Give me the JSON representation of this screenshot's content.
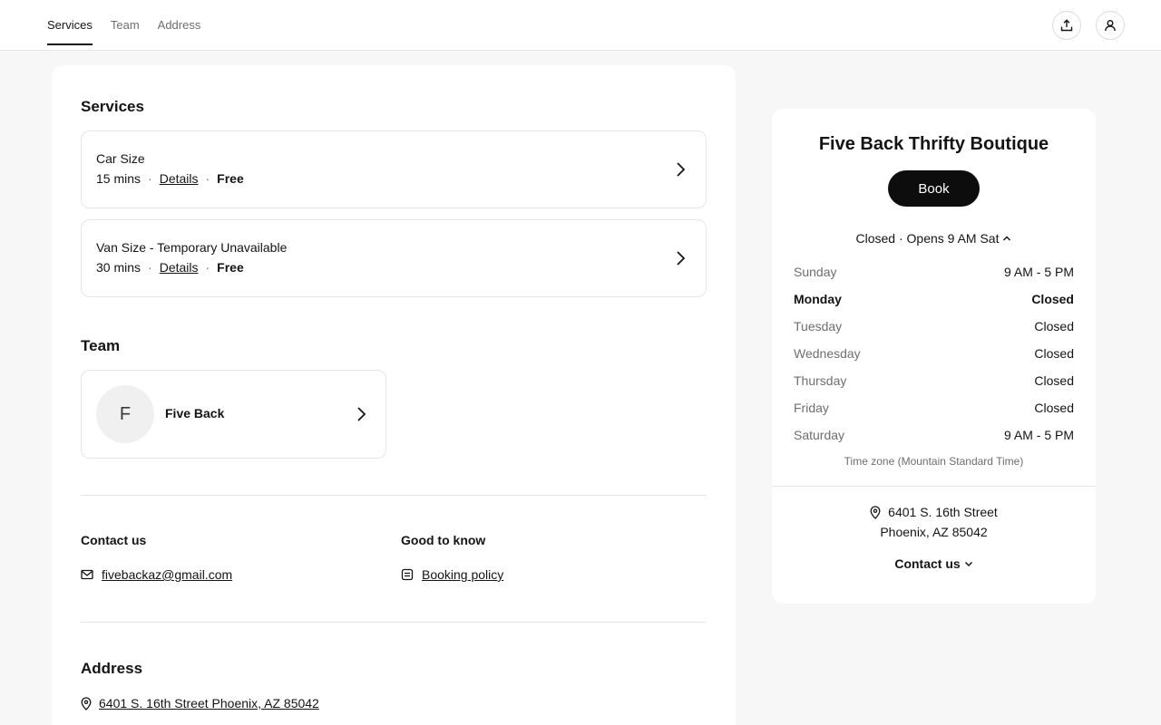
{
  "nav": {
    "tabs": [
      {
        "label": "Services"
      },
      {
        "label": "Team"
      },
      {
        "label": "Address"
      }
    ]
  },
  "services": {
    "title": "Services",
    "items": [
      {
        "name": "Car Size",
        "duration": "15 mins",
        "details": "Details",
        "price": "Free"
      },
      {
        "name": "Van Size - Temporary Unavailable",
        "duration": "30 mins",
        "details": "Details",
        "price": "Free"
      }
    ],
    "separator": "·"
  },
  "team": {
    "title": "Team",
    "members": [
      {
        "initial": "F",
        "name": "Five Back"
      }
    ]
  },
  "contact": {
    "title": "Contact us",
    "email": "fivebackaz@gmail.com"
  },
  "good_to_know": {
    "title": "Good to know",
    "policy": "Booking policy"
  },
  "address": {
    "title": "Address",
    "full": "6401 S. 16th Street Phoenix, AZ 85042"
  },
  "business": {
    "name": "Five Back Thrifty Boutique",
    "book_label": "Book",
    "status": "Closed · Opens 9 AM Sat",
    "hours": [
      {
        "day": "Sunday",
        "time": "9 AM - 5 PM"
      },
      {
        "day": "Monday",
        "time": "Closed"
      },
      {
        "day": "Tuesday",
        "time": "Closed"
      },
      {
        "day": "Wednesday",
        "time": "Closed"
      },
      {
        "day": "Thursday",
        "time": "Closed"
      },
      {
        "day": "Friday",
        "time": "Closed"
      },
      {
        "day": "Saturday",
        "time": "9 AM - 5 PM"
      }
    ],
    "timezone": "Time zone (Mountain Standard Time)",
    "address_line1": "6401 S. 16th Street",
    "address_line2": "Phoenix, AZ 85042",
    "contact_label": "Contact us"
  }
}
